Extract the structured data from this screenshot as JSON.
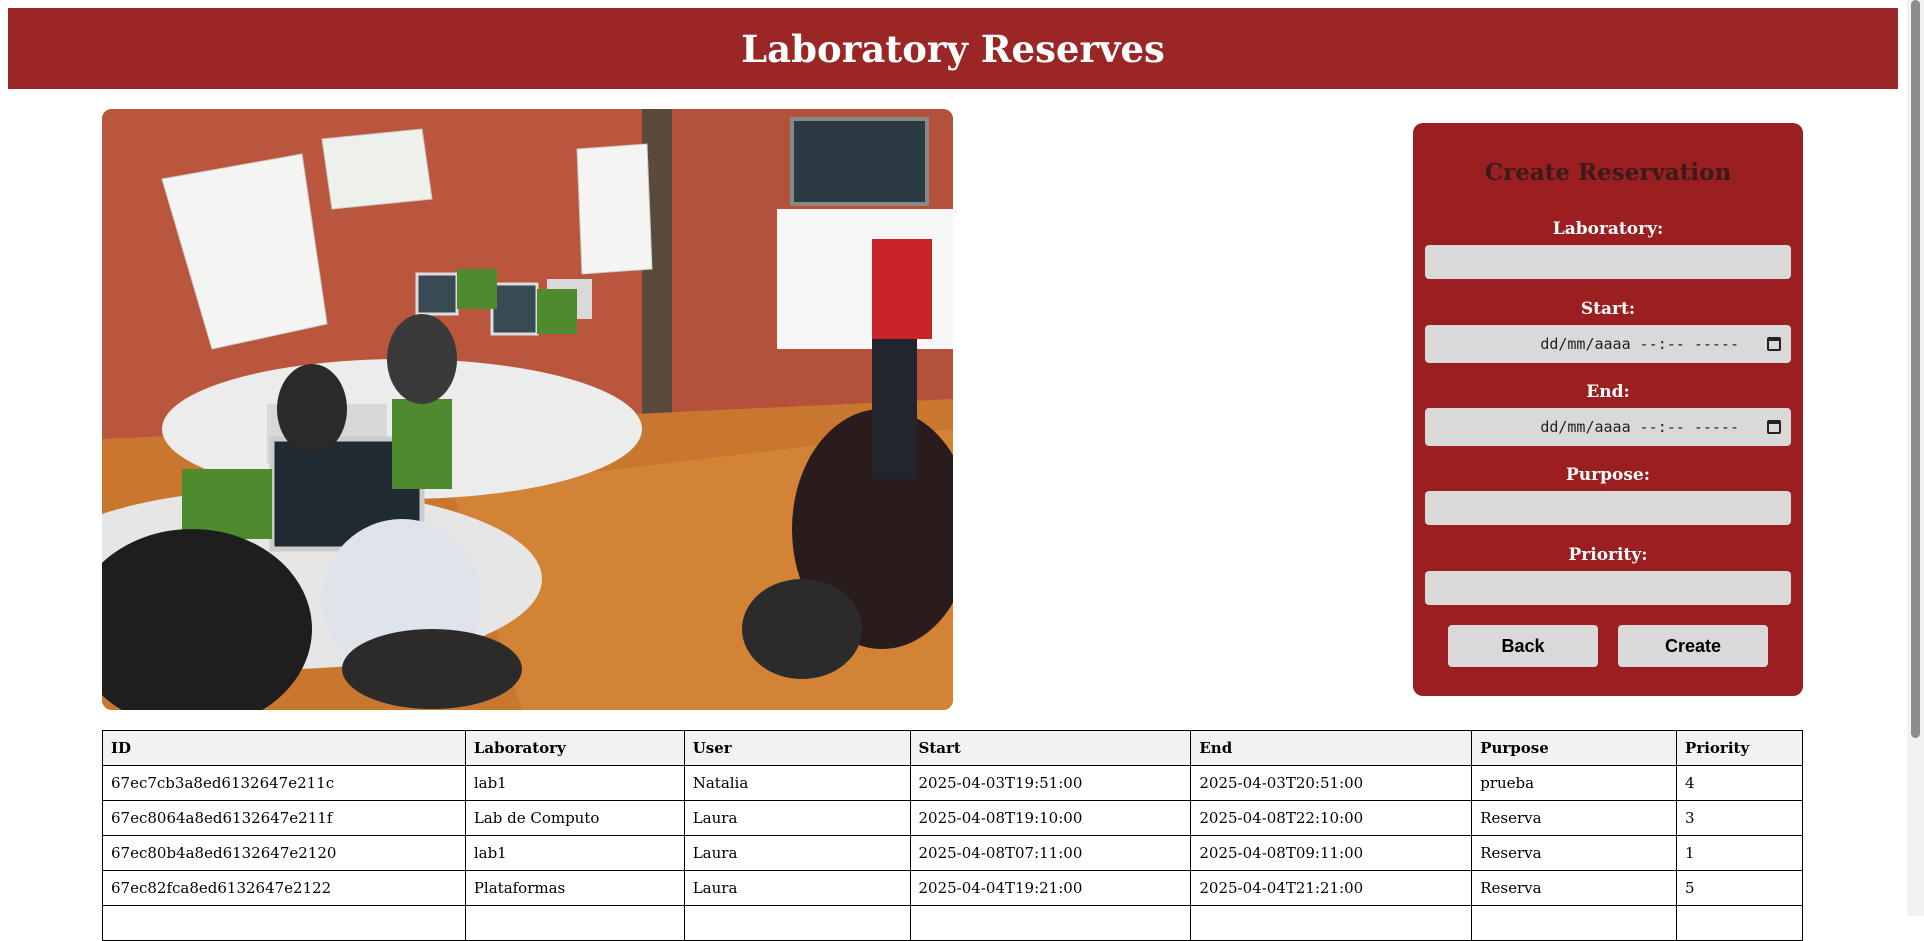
{
  "header": {
    "title": "Laboratory Reserves"
  },
  "form": {
    "title": "Create Reservation",
    "fields": [
      {
        "label": "Laboratory:",
        "value": ""
      },
      {
        "label": "Start:",
        "value": "dd/mm/aaaa --:-- -----"
      },
      {
        "label": "End:",
        "value": "dd/mm/aaaa --:-- -----"
      },
      {
        "label": "Purpose:",
        "value": ""
      },
      {
        "label": "Priority:",
        "value": ""
      }
    ],
    "back_label": "Back",
    "create_label": "Create"
  },
  "table": {
    "headers": [
      "ID",
      "Laboratory",
      "User",
      "Start",
      "End",
      "Purpose",
      "Priority"
    ],
    "rows": [
      [
        "67ec7cb3a8ed6132647e211c",
        "lab1",
        "Natalia",
        "2025-04-03T19:51:00",
        "2025-04-03T20:51:00",
        "prueba",
        "4"
      ],
      [
        "67ec8064a8ed6132647e211f",
        "Lab de Computo",
        "Laura",
        "2025-04-08T19:10:00",
        "2025-04-08T22:10:00",
        "Reserva",
        "3"
      ],
      [
        "67ec80b4a8ed6132647e2120",
        "lab1",
        "Laura",
        "2025-04-08T07:11:00",
        "2025-04-08T09:11:00",
        "Reserva",
        "1"
      ],
      [
        "67ec82fca8ed6132647e2122",
        "Plataformas",
        "Laura",
        "2025-04-04T19:21:00",
        "2025-04-04T21:21:00",
        "Reserva",
        "5"
      ],
      [
        "",
        "",
        "",
        "",
        "",
        "",
        ""
      ]
    ]
  }
}
